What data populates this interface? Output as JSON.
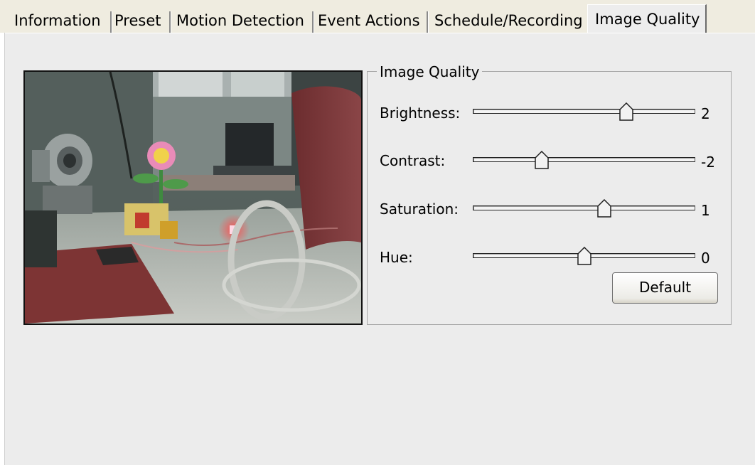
{
  "tabs": [
    {
      "label": "Information",
      "active": false
    },
    {
      "label": "Preset",
      "active": false
    },
    {
      "label": "Motion Detection",
      "active": false
    },
    {
      "label": "Event Actions",
      "active": false
    },
    {
      "label": "Schedule/Recording",
      "active": false
    },
    {
      "label": "Image Quality",
      "active": true
    }
  ],
  "group": {
    "title": "Image Quality"
  },
  "sliders": [
    {
      "label": "Brightness:",
      "value": "2",
      "position": 0.69
    },
    {
      "label": "Contrast:",
      "value": "-2",
      "position": 0.31
    },
    {
      "label": "Saturation:",
      "value": "1",
      "position": 0.59
    },
    {
      "label": "Hue:",
      "value": "0",
      "position": 0.5
    }
  ],
  "buttons": {
    "default_label": "Default"
  }
}
